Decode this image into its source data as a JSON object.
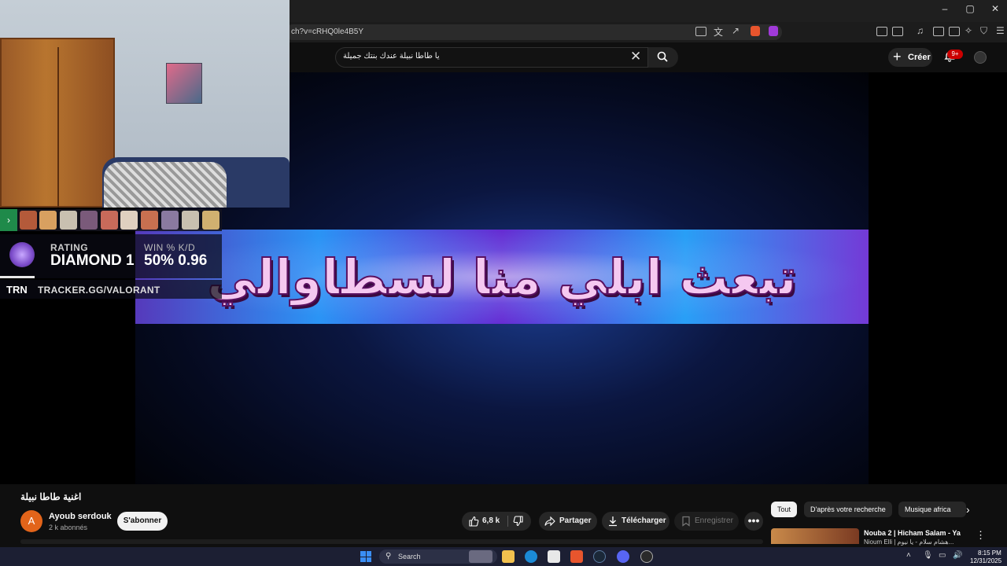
{
  "browser": {
    "url": "ch?v=cRHQ0le4B5Y",
    "window_controls": [
      "–",
      "▢",
      "✕"
    ]
  },
  "youtube": {
    "search_query": "يا طاطا نبيلة عندك بنتك جميلة",
    "create_label": "Créer",
    "notification_badge": "9+"
  },
  "video": {
    "overlay_text": "تبعث ابلي منا لسطاوالي",
    "title": "اغنية طاطا نبيلة",
    "channel": {
      "initial": "A",
      "name": "Ayoub serdouk",
      "subscribers": "2 k abonnés",
      "subscribe_label": "S'abonner"
    },
    "actions": {
      "likes": "6,8 k",
      "share": "Partager",
      "download": "Télécharger",
      "save": "Enregistrer",
      "more": "•••"
    }
  },
  "tracker": {
    "rating_label": "RATING",
    "rating_value": "DIAMOND 1",
    "winkd_label": "WIN % K/D",
    "winkd_value": "50% 0.96",
    "logo": "TRN",
    "url": "TRACKER.GG/VALORANT"
  },
  "recommendations": {
    "chips": [
      "Tout",
      "D'après votre recherche",
      "Musique africa"
    ],
    "first": {
      "title": "Nouba 2 | Hicham Salam - Ya",
      "subtitle": "Nioum Elli | هشام سلام - يا نيوم..."
    }
  },
  "taskbar": {
    "search_label": "Search",
    "time": "8:15 PM",
    "date": "12/31/2025"
  },
  "colors": {
    "youtube_red": "#cc0000",
    "channel_avatar": "#e2641a",
    "tracker_green": "#1f8a4a"
  }
}
